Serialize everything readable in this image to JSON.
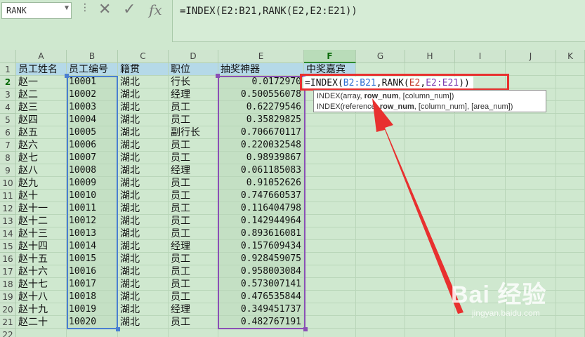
{
  "name_box": "RANK",
  "formula_bar": {
    "text": "=INDEX(E2:B21,RANK(E2,E2:E21))",
    "cancel_icon": "✕",
    "enter_icon": "✓",
    "fx_icon": "fx"
  },
  "columns": [
    "A",
    "B",
    "C",
    "D",
    "E",
    "F",
    "G",
    "H",
    "I",
    "J",
    "K"
  ],
  "headers": {
    "name": "员工姓名",
    "id": "员工编号",
    "origin": "籍贯",
    "title": "职位",
    "lottery": "抽奖神器",
    "winner": "中奖嘉宾"
  },
  "rows": [
    {
      "n": "1"
    },
    {
      "n": "2",
      "name": "赵一",
      "id": "10001",
      "origin": "湖北",
      "title": "行长",
      "val": "0.0172970"
    },
    {
      "n": "3",
      "name": "赵二",
      "id": "10002",
      "origin": "湖北",
      "title": "经理",
      "val": "0.500556078"
    },
    {
      "n": "4",
      "name": "赵三",
      "id": "10003",
      "origin": "湖北",
      "title": "员工",
      "val": "0.62279546"
    },
    {
      "n": "5",
      "name": "赵四",
      "id": "10004",
      "origin": "湖北",
      "title": "员工",
      "val": "0.35829825"
    },
    {
      "n": "6",
      "name": "赵五",
      "id": "10005",
      "origin": "湖北",
      "title": "副行长",
      "val": "0.706670117"
    },
    {
      "n": "7",
      "name": "赵六",
      "id": "10006",
      "origin": "湖北",
      "title": "员工",
      "val": "0.220032548"
    },
    {
      "n": "8",
      "name": "赵七",
      "id": "10007",
      "origin": "湖北",
      "title": "员工",
      "val": "0.98939867"
    },
    {
      "n": "9",
      "name": "赵八",
      "id": "10008",
      "origin": "湖北",
      "title": "经理",
      "val": "0.061185083"
    },
    {
      "n": "10",
      "name": "赵九",
      "id": "10009",
      "origin": "湖北",
      "title": "员工",
      "val": "0.91052626"
    },
    {
      "n": "11",
      "name": "赵十",
      "id": "10010",
      "origin": "湖北",
      "title": "员工",
      "val": "0.747660537"
    },
    {
      "n": "12",
      "name": "赵十一",
      "id": "10011",
      "origin": "湖北",
      "title": "员工",
      "val": "0.116404798"
    },
    {
      "n": "13",
      "name": "赵十二",
      "id": "10012",
      "origin": "湖北",
      "title": "员工",
      "val": "0.142944964"
    },
    {
      "n": "14",
      "name": "赵十三",
      "id": "10013",
      "origin": "湖北",
      "title": "员工",
      "val": "0.893616081"
    },
    {
      "n": "15",
      "name": "赵十四",
      "id": "10014",
      "origin": "湖北",
      "title": "经理",
      "val": "0.157609434"
    },
    {
      "n": "16",
      "name": "赵十五",
      "id": "10015",
      "origin": "湖北",
      "title": "员工",
      "val": "0.928459075"
    },
    {
      "n": "17",
      "name": "赵十六",
      "id": "10016",
      "origin": "湖北",
      "title": "员工",
      "val": "0.958003084"
    },
    {
      "n": "18",
      "name": "赵十七",
      "id": "10017",
      "origin": "湖北",
      "title": "员工",
      "val": "0.573007141"
    },
    {
      "n": "19",
      "name": "赵十八",
      "id": "10018",
      "origin": "湖北",
      "title": "员工",
      "val": "0.476535844"
    },
    {
      "n": "20",
      "name": "赵十九",
      "id": "10019",
      "origin": "湖北",
      "title": "经理",
      "val": "0.349451737"
    },
    {
      "n": "21",
      "name": "赵二十",
      "id": "10020",
      "origin": "湖北",
      "title": "员工",
      "val": "0.482767191"
    },
    {
      "n": "22"
    }
  ],
  "edit": {
    "prefix": "=INDEX(",
    "ref1": "B2:B21",
    "mid": ",RANK(",
    "ref2": "E2",
    "comma": ",",
    "ref3": "E2:E21",
    "suffix": "))"
  },
  "tooltip": {
    "line1_a": "INDEX(array, ",
    "line1_b": "row_num",
    "line1_c": ", [column_num])",
    "line2_a": "INDEX(reference, ",
    "line2_b": "row_num",
    "line2_c": ", [column_num], [area_num])"
  },
  "watermark": {
    "logo": "Bai 经验",
    "sub": "jingyan.baidu.com"
  },
  "colors": {
    "accent": "#e8302f",
    "range_b": "#4a7fd1",
    "range_e": "#8a4fb5"
  }
}
